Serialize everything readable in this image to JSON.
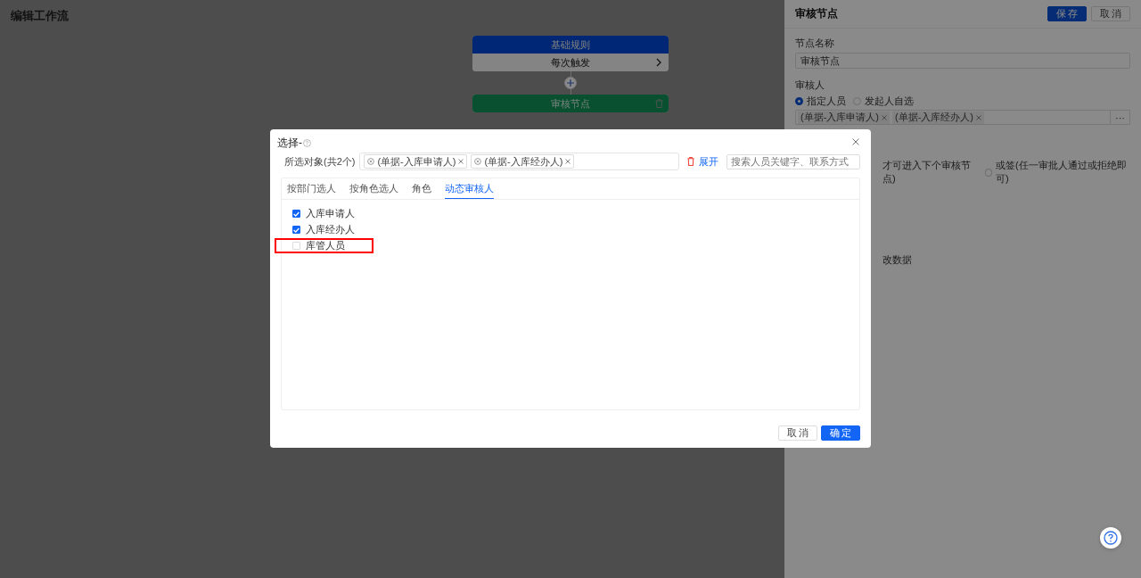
{
  "page": {
    "title": "编辑工作流"
  },
  "flow": {
    "nodes": [
      {
        "kind": "rule",
        "header": "基础规则",
        "body": "每次触发"
      },
      {
        "kind": "approval",
        "header": "审核节点"
      }
    ]
  },
  "panel": {
    "title": "审核节点",
    "save_button": "保存",
    "cancel_button": "取消",
    "node_name_label": "节点名称",
    "node_name_value": "审核节点",
    "approver_label": "审核人",
    "approver_options": [
      {
        "label": "指定人员",
        "selected": true
      },
      {
        "label": "发起人自选",
        "selected": false
      }
    ],
    "approver_tags": [
      "(单据-入库申请人)",
      "(单据-入库经办人)"
    ],
    "more_button": "···",
    "sign_partial_text": "才可进入下个审核节点)",
    "sign_options": [
      {
        "label": "或签(任一审批人通过或拒绝即可)",
        "selected": false
      }
    ],
    "edit_partial_text": "改数据"
  },
  "modal": {
    "title": "选择-",
    "selected_label": "所选对象(共2个)",
    "selected_tags": [
      "(单据-入库申请人)",
      "(单据-入库经办人)"
    ],
    "expand_link": "展开",
    "search": {
      "placeholder": "搜索人员关键字、联系方式"
    },
    "tabs": [
      {
        "label": "按部门选人",
        "selected": false
      },
      {
        "label": "按角色选人",
        "selected": false
      },
      {
        "label": "角色",
        "selected": false
      },
      {
        "label": "动态审核人",
        "selected": true
      }
    ],
    "options": [
      {
        "label": "入库申请人",
        "checked": true,
        "highlighted": false
      },
      {
        "label": "入库经办人",
        "checked": true,
        "highlighted": false
      },
      {
        "label": "库管人员",
        "checked": false,
        "highlighted": true
      }
    ],
    "cancel_button": "取消",
    "confirm_button": "确定"
  }
}
